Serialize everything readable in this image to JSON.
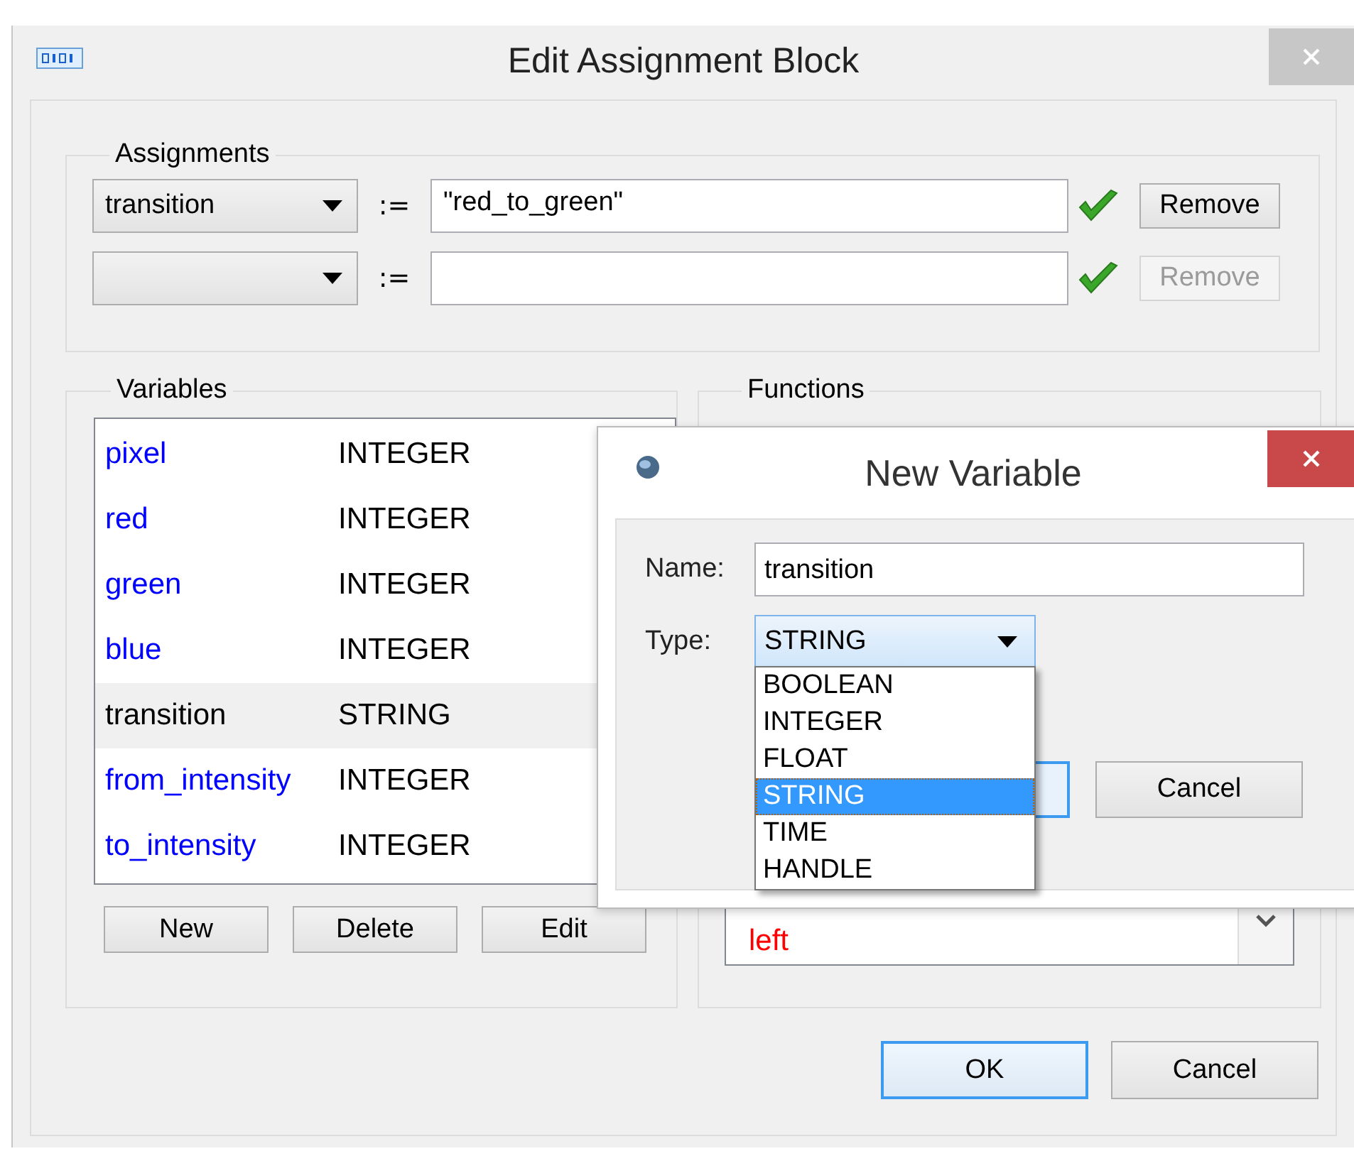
{
  "window": {
    "title": "Edit Assignment Block"
  },
  "assignments": {
    "label": "Assignments",
    "rows": [
      {
        "variable": "transition",
        "operator": ":=",
        "expression": "\"red_to_green\"",
        "valid": true,
        "remove": {
          "label": "Remove",
          "disabled": false
        }
      },
      {
        "operator": ":=",
        "valid": true,
        "remove": {
          "label": "Remove",
          "disabled": true
        }
      }
    ]
  },
  "variables": {
    "label": "Variables",
    "items": [
      {
        "name": "pixel",
        "type": "INTEGER",
        "color": "#0000ff",
        "selected": false
      },
      {
        "name": "red",
        "type": "INTEGER",
        "color": "#0000ff",
        "selected": false
      },
      {
        "name": "green",
        "type": "INTEGER",
        "color": "#0000ff",
        "selected": false
      },
      {
        "name": "blue",
        "type": "INTEGER",
        "color": "#0000ff",
        "selected": false
      },
      {
        "name": "transition",
        "type": "STRING",
        "color": "#000000",
        "selected": true
      },
      {
        "name": "from_intensity",
        "type": "INTEGER",
        "color": "#0000ff",
        "selected": false
      },
      {
        "name": "to_intensity",
        "type": "INTEGER",
        "color": "#0000ff",
        "selected": false
      }
    ],
    "buttons": [
      "New",
      "Delete",
      "Edit"
    ]
  },
  "functions": {
    "label": "Functions",
    "items": [
      {
        "name": "left",
        "color": "#ff0000"
      }
    ]
  },
  "buttons": [
    {
      "label": "OK",
      "default": true
    },
    {
      "label": "Cancel",
      "default": false
    }
  ],
  "dialog": {
    "title": "New Variable",
    "name_label": "Name:",
    "name_value": "transition",
    "type_label": "Type:",
    "type_value": "STRING",
    "type_options": [
      {
        "label": "BOOLEAN",
        "selected": false
      },
      {
        "label": "INTEGER",
        "selected": false
      },
      {
        "label": "FLOAT",
        "selected": false
      },
      {
        "label": "STRING",
        "selected": true
      },
      {
        "label": "TIME",
        "selected": false
      },
      {
        "label": "HANDLE",
        "selected": false
      }
    ],
    "cancel": "Cancel"
  }
}
